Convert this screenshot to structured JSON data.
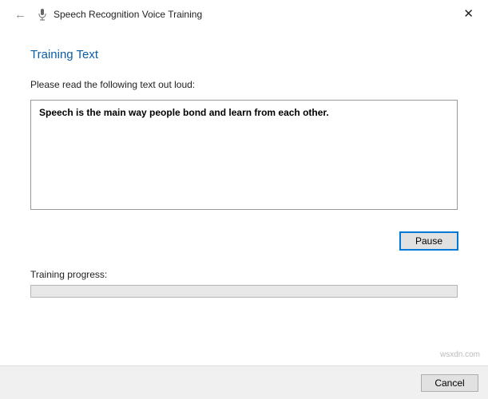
{
  "window": {
    "title": "Speech Recognition Voice Training"
  },
  "page": {
    "heading": "Training Text",
    "instruction": "Please read the following text out loud:",
    "sentence": "Speech is the main way people bond and learn from each other.",
    "progress_label": "Training progress:"
  },
  "buttons": {
    "pause": "Pause",
    "cancel": "Cancel"
  },
  "watermark": "wsxdn.com"
}
